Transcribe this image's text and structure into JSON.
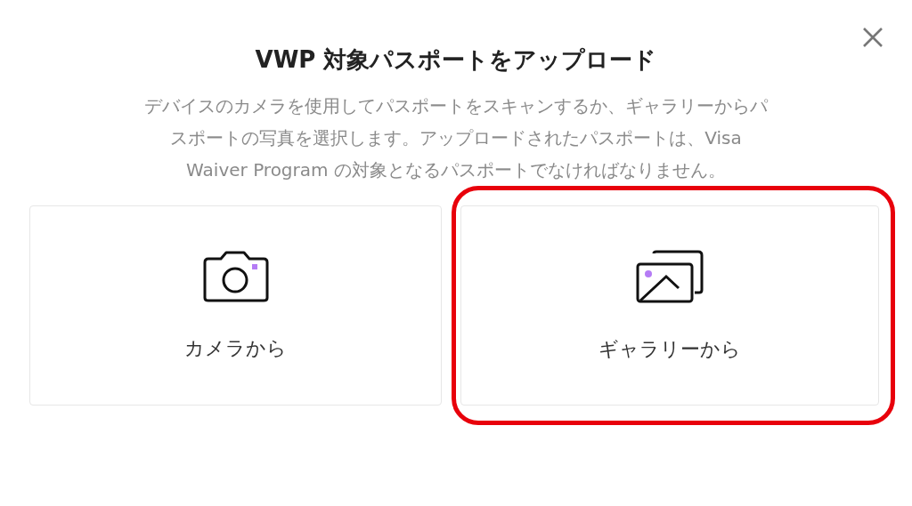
{
  "title": "VWP 対象パスポートをアップロード",
  "description": "デバイスのカメラを使用してパスポートをスキャンするか、ギャラリーからパスポートの写真を選択します。アップロードされたパスポートは、Visa Waiver Program の対象となるパスポートでなければなりません。",
  "options": [
    {
      "kind": "camera",
      "label": "カメラから",
      "highlighted": false
    },
    {
      "kind": "gallery",
      "label": "ギャラリーから",
      "highlighted": true
    }
  ]
}
